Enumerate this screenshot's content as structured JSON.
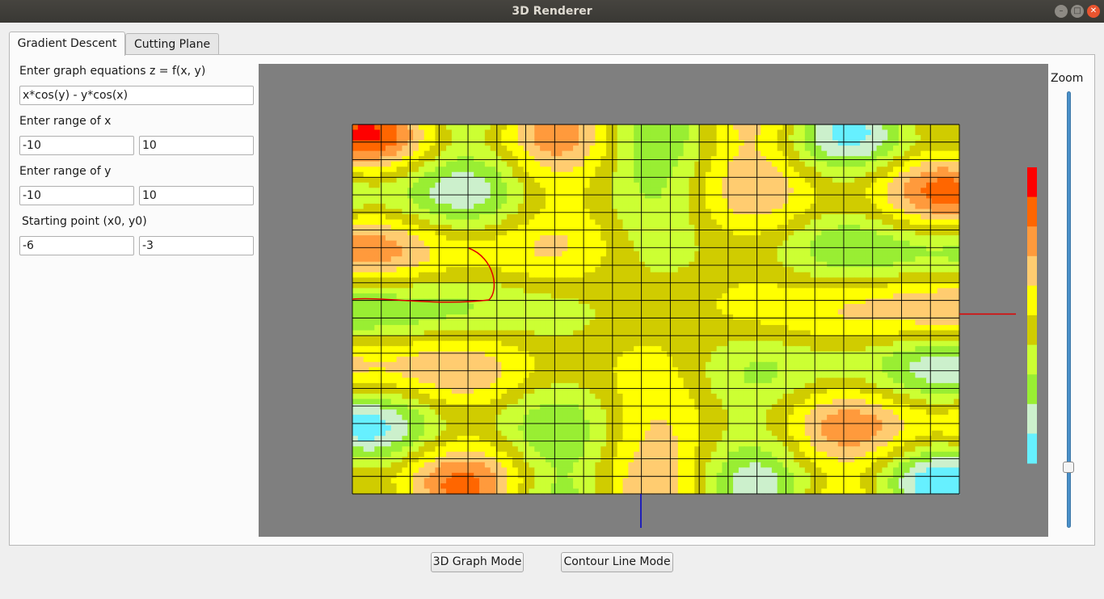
{
  "window": {
    "title": "3D Renderer"
  },
  "tabs": [
    {
      "label": "Gradient Descent",
      "active": true
    },
    {
      "label": "Cutting Plane",
      "active": false
    }
  ],
  "form": {
    "equation_label": "Enter graph equations z = f(x, y)",
    "equation_value": "x*cos(y) - y*cos(x)",
    "range_x_label": "Enter range of x",
    "x_min": "-10",
    "x_max": "10",
    "range_y_label": "Enter range of y",
    "y_min": "-10",
    "y_max": "10",
    "start_label": "Starting point (x0, y0)",
    "x0": "-6",
    "y0": "-3"
  },
  "zoom": {
    "label": "Zoom",
    "level": 0.13
  },
  "buttons": {
    "graph_mode": "3D Graph Mode",
    "contour_mode": "Contour Line Mode"
  },
  "colors": {
    "background": "#7f7f7f",
    "grid_line": "#000000",
    "path": "#e00000",
    "x_axis": "#e00000",
    "y_axis": "#0000cc",
    "scale": [
      "#fe0000",
      "#ff6600",
      "#ff9a3c",
      "#ffcc70",
      "#ffff00",
      "#d0cc00",
      "#ccff33",
      "#99ee33",
      "#ccf0cc",
      "#66f0ff"
    ]
  }
}
